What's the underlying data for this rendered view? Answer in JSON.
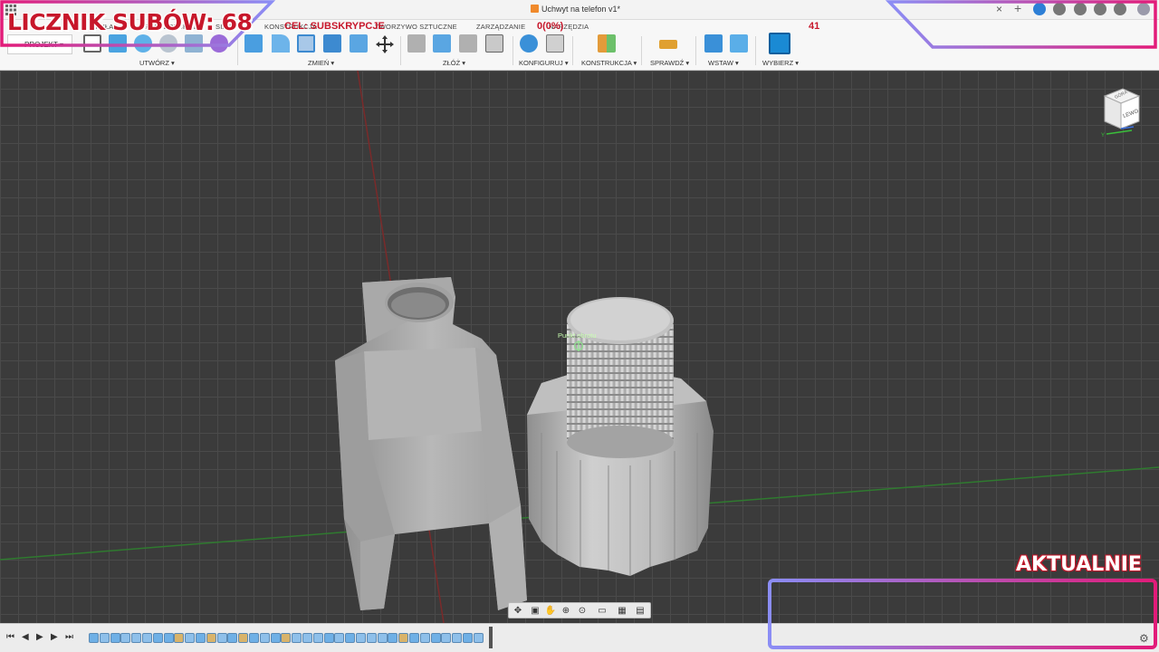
{
  "window": {
    "title": "Uchwyt na telefon v1*",
    "close_tab": "×"
  },
  "ribbon": {
    "workspace": "PROJEKT",
    "tabs": [
      "BRYŁA",
      "POWIERZCHNIA",
      "SIATKA",
      "KONSTRUKCJA",
      "TWORZYWO SZTUCZNE",
      "ZARZĄDZANIE",
      "NARZĘDZIA"
    ],
    "groups": {
      "create": "UTWÓRZ",
      "modify": "ZMIEŃ",
      "assemble": "ZŁÓŻ",
      "configure": "KONFIGURUJ",
      "construct": "KONSTRUKCJA",
      "inspect": "SPRAWDŹ",
      "insert": "WSTAW",
      "select": "WYBIERZ"
    }
  },
  "viewport": {
    "pivot_label": "Punkt obrotu",
    "viewcube": {
      "front": "LEWO",
      "top": "GÓRA",
      "axis_y": "Y"
    }
  },
  "overlay": {
    "sub_counter": "LICZNIK SUBÓW: 68",
    "goal_label": "CEL: SUBSKRYPCJE",
    "goal_value": "0(0%)",
    "goal_right": "41",
    "now_label": "AKTUALNIE",
    "accent_red": "#c7172b",
    "frame_blue": "#8b8df5",
    "frame_pink": "#e21b79"
  },
  "timeline": {
    "controls": [
      "skip-start",
      "step-back",
      "play",
      "step-forward",
      "skip-end"
    ],
    "features": [
      "sketch",
      "extrude",
      "sketch",
      "extrude",
      "extrude",
      "extrude",
      "sketch",
      "sketch",
      "plane",
      "extrude",
      "sketch",
      "plane",
      "extrude",
      "sketch",
      "plane",
      "sketch",
      "extrude",
      "sketch",
      "plane",
      "extrude",
      "extrude",
      "extrude",
      "sketch",
      "extrude",
      "sketch",
      "extrude",
      "extrude",
      "extrude",
      "sketch",
      "plane",
      "sketch",
      "extrude",
      "sketch",
      "extrude",
      "extrude",
      "sketch",
      "extrude"
    ]
  }
}
